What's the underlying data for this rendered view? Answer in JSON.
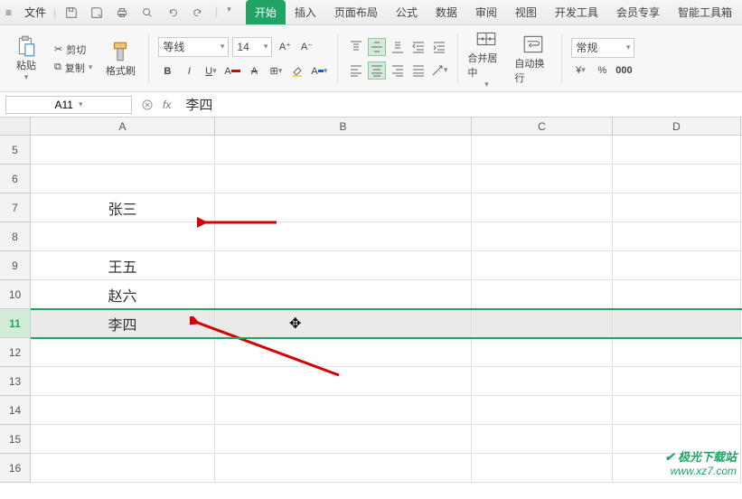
{
  "topbar": {
    "file_label": "文件",
    "tabs": [
      "开始",
      "插入",
      "页面布局",
      "公式",
      "数据",
      "审阅",
      "视图",
      "开发工具",
      "会员专享",
      "智能工具箱"
    ],
    "active_tab_index": 0
  },
  "ribbon": {
    "paste_label": "粘贴",
    "cut_label": "剪切",
    "copy_label": "复制",
    "format_painter_label": "格式刷",
    "font_name": "等线",
    "font_size": "14",
    "merge_label": "合并居中",
    "wrap_label": "自动换行",
    "number_format_label": "常规"
  },
  "formula_bar": {
    "cell_ref": "A11",
    "fx_label": "fx",
    "value": "李四"
  },
  "columns": [
    "A",
    "B",
    "C",
    "D"
  ],
  "rows": [
    {
      "num": "5",
      "a": ""
    },
    {
      "num": "6",
      "a": ""
    },
    {
      "num": "7",
      "a": "张三"
    },
    {
      "num": "8",
      "a": ""
    },
    {
      "num": "9",
      "a": "王五"
    },
    {
      "num": "10",
      "a": "赵六"
    },
    {
      "num": "11",
      "a": "李四",
      "selected": true
    },
    {
      "num": "12",
      "a": ""
    },
    {
      "num": "13",
      "a": ""
    },
    {
      "num": "14",
      "a": ""
    },
    {
      "num": "15",
      "a": ""
    },
    {
      "num": "16",
      "a": ""
    }
  ],
  "watermark": {
    "brand": "极光下载站",
    "url": "www.xz7.com"
  }
}
